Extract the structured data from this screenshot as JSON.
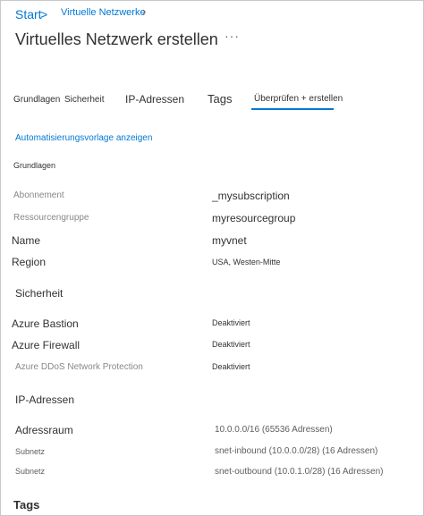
{
  "breadcrumb": {
    "start": "Start",
    "separator": ">",
    "parent": "Virtuelle Netzwerke",
    "chevron": "›"
  },
  "page": {
    "title": "Virtuelles Netzwerk erstellen",
    "more": "···"
  },
  "tabs": [
    {
      "label": "Grundlagen"
    },
    {
      "label": "Sicherheit"
    },
    {
      "label": "IP-Adressen"
    },
    {
      "label": "Tags"
    },
    {
      "label": "Überprüfen + erstellen",
      "active": true
    }
  ],
  "template_link": "Automatisierungsvorlage anzeigen",
  "sections": {
    "basics": {
      "heading": "Grundlagen",
      "rows": [
        {
          "label": "Abonnement",
          "value": "_mysubscription"
        },
        {
          "label": "Ressourcengruppe",
          "value": "myresourcegroup"
        },
        {
          "label": "Name",
          "value": "myvnet"
        },
        {
          "label": "Region",
          "value": "USA, Westen-Mitte"
        }
      ]
    },
    "security": {
      "heading": "Sicherheit",
      "rows": [
        {
          "label": "Azure Bastion",
          "value": "Deaktiviert"
        },
        {
          "label": "Azure Firewall",
          "value": "Deaktiviert"
        },
        {
          "label": "Azure DDoS Network Protection",
          "value": "Deaktiviert"
        }
      ]
    },
    "ip": {
      "heading": "IP-Adressen",
      "rows": [
        {
          "label": "Adressraum",
          "value": "10.0.0.0/16 (65536 Adressen)"
        },
        {
          "label": "Subnetz",
          "value": "snet-inbound (10.0.0.0/28) (16 Adressen)"
        },
        {
          "label": "Subnetz",
          "value": "snet-outbound (10.0.1.0/28) (16 Adressen)"
        }
      ]
    },
    "tags": {
      "heading": "Tags"
    }
  },
  "colors": {
    "accent": "#0078d4",
    "text": "#323130",
    "muted": "#8a8886",
    "border": "#c8c8c8"
  }
}
